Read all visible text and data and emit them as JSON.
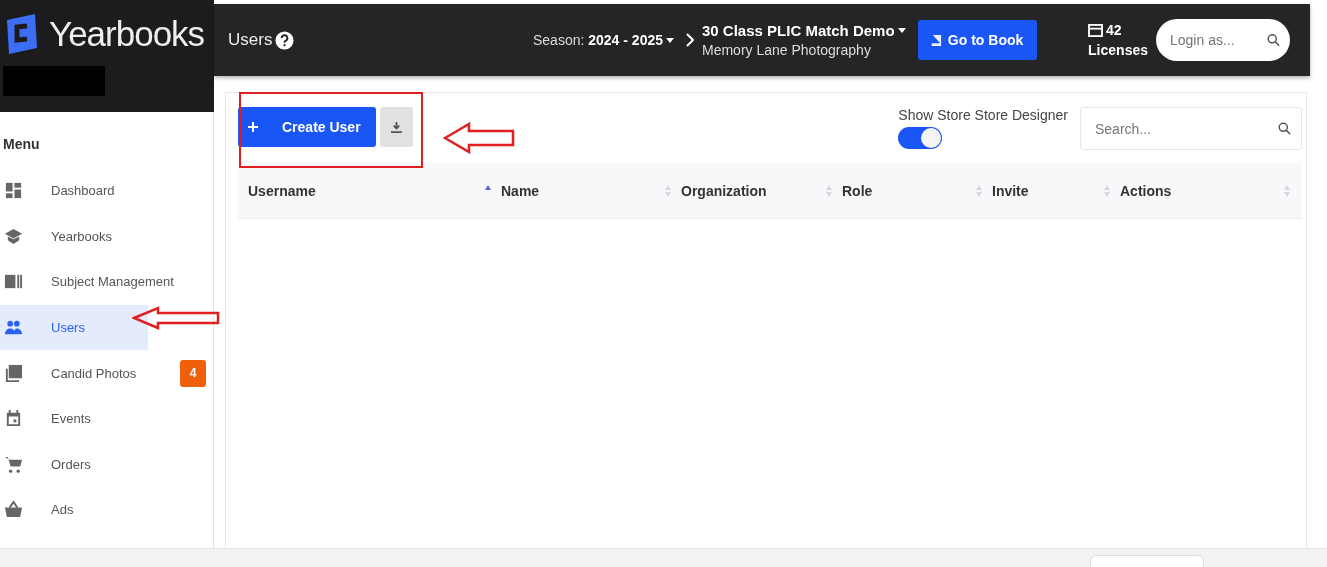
{
  "brand": {
    "name": "Yearbooks"
  },
  "header": {
    "title": "Users",
    "season_label": "Season:",
    "season": "2024 - 2025",
    "book": "30 Class PLIC Match Demo",
    "studio": "Memory Lane Photography",
    "go_button": "Go to Book",
    "licenses_count": "42",
    "licenses_label": "Licenses",
    "login": {
      "placeholder": "Login as..."
    }
  },
  "sidebar": {
    "heading": "Menu",
    "items": [
      {
        "label": "Dashboard",
        "selected": false
      },
      {
        "label": "Yearbooks",
        "selected": false
      },
      {
        "label": "Subject Management",
        "selected": false
      },
      {
        "label": "Users",
        "selected": true
      },
      {
        "label": "Candid Photos",
        "selected": false,
        "badge": "4"
      },
      {
        "label": "Events",
        "selected": false
      },
      {
        "label": "Orders",
        "selected": false
      },
      {
        "label": "Ads",
        "selected": false
      }
    ]
  },
  "toolbar": {
    "create_button": "Create User",
    "toggle": {
      "label": "Show Store Store Designer",
      "on": true
    },
    "search": {
      "placeholder": "Search..."
    }
  },
  "table": {
    "columns": [
      {
        "label": "Username",
        "sorted": true
      },
      {
        "label": "Name",
        "sorted": false
      },
      {
        "label": "Organization",
        "sorted": false
      },
      {
        "label": "Role",
        "sorted": false
      },
      {
        "label": "Invite",
        "sorted": false
      },
      {
        "label": "Actions",
        "sorted": false
      }
    ]
  }
}
